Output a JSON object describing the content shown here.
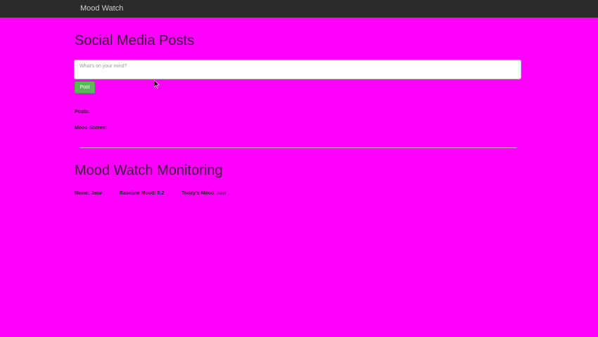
{
  "navbar": {
    "brand": "Mood Watch"
  },
  "posts_section": {
    "title": "Social Media Posts",
    "input_placeholder": "What's on your mind?",
    "post_button_label": "Post",
    "posts_label": "Posts:",
    "mood_scores_label": "Mood Scores:"
  },
  "monitoring_section": {
    "title": "Mood Watch Monitoring",
    "name": "Name: Jane",
    "baseline": "Baseline Mood: 0.2",
    "today": "Today's Mood: nan"
  },
  "colors": {
    "page_background": "#ff00ff",
    "navbar_background": "#2a2a2a",
    "post_button": "#5cb85c"
  },
  "icons": {
    "cursor": "mouse-pointer-icon"
  }
}
